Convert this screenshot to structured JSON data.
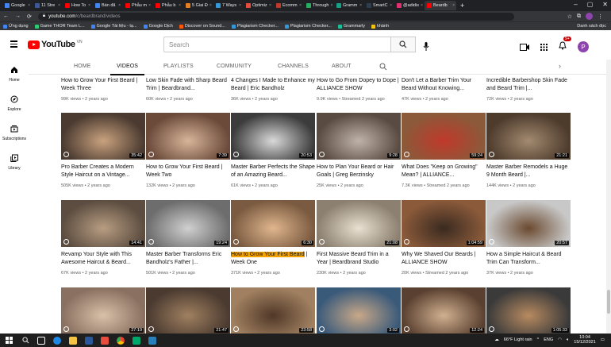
{
  "browser": {
    "tabs": [
      {
        "label": "Google",
        "color": "#4285f4"
      },
      {
        "label": "11 Stre",
        "color": "#3b5998"
      },
      {
        "label": "How To",
        "color": "#ff0000"
      },
      {
        "label": "Bán đã",
        "color": "#4285f4"
      },
      {
        "label": "Phẫu m",
        "color": "#ff0000"
      },
      {
        "label": "Phẫu b",
        "color": "#ff0000"
      },
      {
        "label": "5 Giai Đ",
        "color": "#e67e22"
      },
      {
        "label": "7 Ways",
        "color": "#3498db"
      },
      {
        "label": "Optimiz",
        "color": "#e74c3c"
      },
      {
        "label": "Ecomm",
        "color": "#c0392b"
      },
      {
        "label": "Through",
        "color": "#27ae60"
      },
      {
        "label": "Gramm",
        "color": "#16a085"
      },
      {
        "label": "SmartC",
        "color": "#2c3e50"
      },
      {
        "label": "@adidis",
        "color": "#e1306c"
      },
      {
        "label": "Beardb",
        "color": "#ff0000",
        "active": true
      }
    ],
    "url_host": "youtube.com",
    "url_path": "/c/beardbrand/videos",
    "bookmarks": [
      {
        "label": "Ứng dụng",
        "color": "#4285f4"
      },
      {
        "label": "Game THOR Team L...",
        "color": "#2ecc71"
      },
      {
        "label": "Google Tài liệu - tạ...",
        "color": "#4285f4"
      },
      {
        "label": "Google Dịch",
        "color": "#4285f4"
      },
      {
        "label": "Discover on Sound...",
        "color": "#ff5500"
      },
      {
        "label": "Plagiarism Checker...",
        "color": "#3498db"
      },
      {
        "label": "Plagiarism Checker...",
        "color": "#3498db"
      },
      {
        "label": "Grammarly",
        "color": "#15c39a"
      },
      {
        "label": "khánh",
        "color": "#f1c40f"
      }
    ],
    "reading_list": "Danh sách đọc"
  },
  "youtube": {
    "logo": "YouTube",
    "region": "VN",
    "search_placeholder": "Search",
    "notif_count": "9+",
    "avatar_letter": "P",
    "sidebar": [
      {
        "label": "Home",
        "icon": "home-icon"
      },
      {
        "label": "Explore",
        "icon": "explore-icon"
      },
      {
        "label": "Subscriptions",
        "icon": "subscriptions-icon"
      },
      {
        "label": "Library",
        "icon": "library-icon"
      }
    ],
    "channel_tabs": [
      "HOME",
      "VIDEOS",
      "PLAYLISTS",
      "COMMUNITY",
      "CHANNELS",
      "ABOUT"
    ],
    "active_tab": "VIDEOS",
    "rows": [
      [
        {
          "title": "How to Grow Your First Beard | Week Three",
          "meta": "99K views • 2 years ago"
        },
        {
          "title": "Low Skin Fade with Sharp Beard Trim | Beardbrand...",
          "meta": "60K views • 2 years ago"
        },
        {
          "title": "4 Changes I Made to Enhance my Beard | Eric Bandholz",
          "meta": "36K views • 2 years ago"
        },
        {
          "title": "How to Go From Dopey to Dope | ALLIANCE SHOW",
          "meta": "9.9K views • Streamed 2 years ago"
        },
        {
          "title": "Don't Let a Barber Trim Your Beard Without Knowing...",
          "meta": "47K views • 2 years ago"
        },
        {
          "title": "Incredible Barbershop Skin Fade and Beard Trim |...",
          "meta": "72K views • 2 years ago"
        }
      ],
      [
        {
          "title": "Pro Barber Creates a Modern Style Haircut on a Vintage...",
          "meta": "505K views • 2 years ago",
          "duration": "35:42",
          "colors": [
            "#4a3a30",
            "#c9a27e"
          ]
        },
        {
          "title": "How to Grow Your First Beard | Week Two",
          "meta": "132K views • 2 years ago",
          "duration": "7:39",
          "colors": [
            "#6b4a3a",
            "#d7b59a"
          ]
        },
        {
          "title": "Master Barber Perfects the Shape of an Amazing Beard...",
          "meta": "61K views • 2 years ago",
          "duration": "20:53",
          "colors": [
            "#3c3c3c",
            "#d9d9d9"
          ]
        },
        {
          "title": "How to Plan Your Beard or Hair Goals | Greg Berzinsky",
          "meta": "25K views • 2 years ago",
          "duration": "9:28",
          "colors": [
            "#5a4b42",
            "#bfb3a8"
          ]
        },
        {
          "title": "What Does \"Keep on Growing\" Mean? | ALLIANCE...",
          "meta": "7.3K views • Streamed 2 years ago",
          "duration": "59:24",
          "colors": [
            "#8a5a3a",
            "#c0392b"
          ]
        },
        {
          "title": "Master Barber Remodels a Huge 9 Month Beard |...",
          "meta": "144K views • 2 years ago",
          "duration": "21:21",
          "colors": [
            "#4d3b2c",
            "#a38a70"
          ]
        }
      ],
      [
        {
          "title": "Revamp Your Style with This Awesome Haircut & Beard...",
          "meta": "67K views • 2 years ago",
          "duration": "14:41",
          "colors": [
            "#5c4d40",
            "#b89d82"
          ]
        },
        {
          "title": "Master Barber Transforms Eric Bandholz's Father |...",
          "meta": "501K views • 2 years ago",
          "duration": "19:24",
          "colors": [
            "#6d6d6d",
            "#d0d0d0"
          ]
        },
        {
          "title": "How to Grow Your First Beard",
          "title_tail": " | Week One",
          "meta": "371K views • 2 years ago",
          "duration": "6:30",
          "colors": [
            "#7a5a40",
            "#e0b68e"
          ],
          "highlight": true
        },
        {
          "title": "First Massive Beard Trim in a Year | Beardbrand Studio",
          "meta": "230K views • 2 years ago",
          "duration": "21:08",
          "colors": [
            "#8c8070",
            "#e8e0d0"
          ]
        },
        {
          "title": "Why We Shaved Our Beards | ALLIANCE SHOW",
          "meta": "20K views • Streamed 2 years ago",
          "duration": "1:04:59",
          "colors": [
            "#8a5a3a",
            "#3a2a20"
          ]
        },
        {
          "title": "How a Simple Haircut & Beard Trim Can Transform...",
          "meta": "37K views • 2 years ago",
          "duration": "20:57",
          "colors": [
            "#c8c8c8",
            "#6b4a30"
          ]
        }
      ],
      [
        {
          "duration": "27:19",
          "colors": [
            "#8a7060",
            "#d8c0a8"
          ]
        },
        {
          "duration": "21:47",
          "colors": [
            "#4a3a30",
            "#a08060"
          ]
        },
        {
          "duration": "23:58",
          "colors": [
            "#a08060",
            "#503828"
          ]
        },
        {
          "duration": "3:02",
          "colors": [
            "#3a5a7a",
            "#c8a888"
          ]
        },
        {
          "duration": "12:24",
          "colors": [
            "#5a4030",
            "#d0b090"
          ]
        },
        {
          "duration": "1:05:33",
          "colors": [
            "#3a3a3a",
            "#b88a60"
          ]
        }
      ]
    ]
  },
  "taskbar": {
    "weather": "66°F  Light rain",
    "lang": "ENG",
    "time": "10:04",
    "date": "15/12/2021"
  }
}
